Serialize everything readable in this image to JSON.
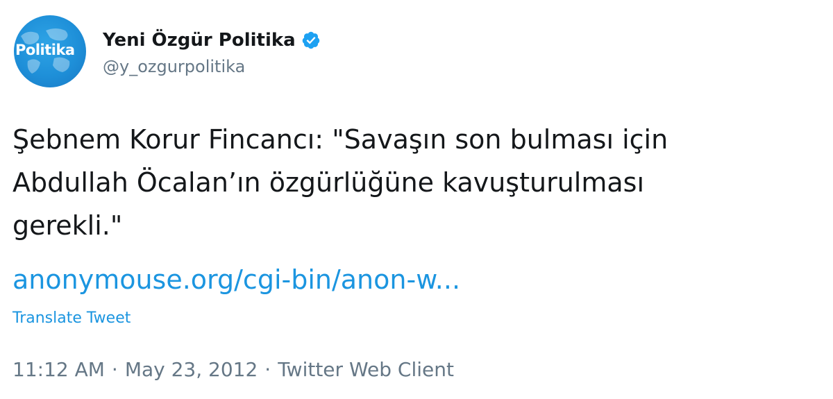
{
  "tweet": {
    "avatar_label": "Politika",
    "display_name": "Yeni Özgür Politika",
    "handle": "@y_ozgurpolitika",
    "verified": true,
    "text_lines": [
      "Şebnem Korur Fincancı: \"Savaşın son bulması için",
      "Abdullah Öcalan’ın özgürlüğüne kavuşturulması",
      "gerekli.\""
    ],
    "link_text": "anonymouse.org/cgi-bin/anon-w...",
    "translate_label": "Translate Tweet",
    "time": "11:12 AM",
    "separator": "·",
    "date": "May 23, 2012",
    "client": "Twitter Web Client"
  },
  "colors": {
    "link": "#1b95e0",
    "muted": "#657786",
    "text": "#14171a",
    "avatar": "#1e8fd8",
    "verified_badge": "#1da1f2"
  },
  "icons": {
    "verified": "verified-badge-icon"
  }
}
